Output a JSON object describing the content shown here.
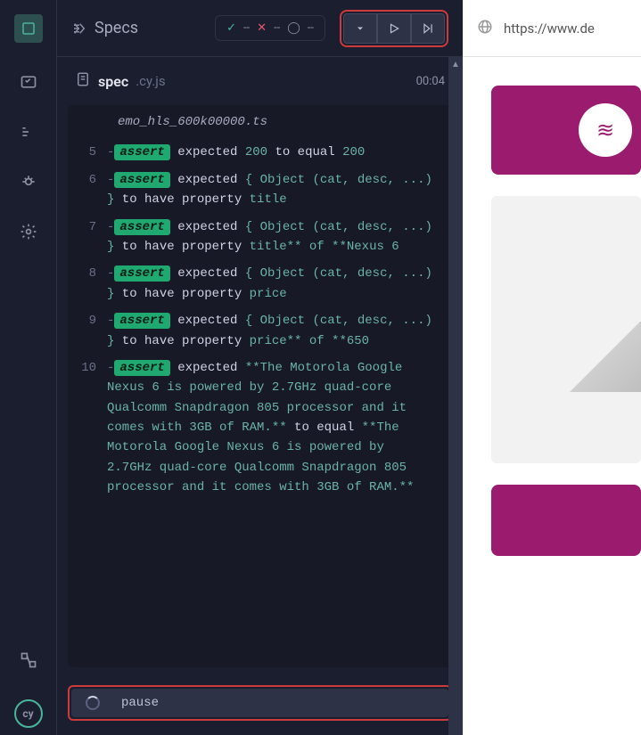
{
  "header": {
    "title": "Specs",
    "stats": {
      "pass": "--",
      "fail": "--",
      "pending": "--"
    }
  },
  "spec": {
    "name": "spec",
    "ext": ".cy.js",
    "time": "00:04"
  },
  "preamble": "emo_hls_600k00000.ts",
  "log": [
    {
      "n": "5",
      "parts": [
        {
          "t": "tag",
          "v": "assert"
        },
        {
          "t": "txt",
          "v": "  expected "
        },
        {
          "t": "kw",
          "v": "200"
        },
        {
          "t": "txt",
          "v": " to equal "
        },
        {
          "t": "kw",
          "v": "200"
        }
      ]
    },
    {
      "n": "6",
      "parts": [
        {
          "t": "tag",
          "v": "assert"
        },
        {
          "t": "txt",
          "v": "  expected "
        },
        {
          "t": "kw",
          "v": "{ Object (cat, desc, ...) }"
        },
        {
          "t": "txt",
          "v": " to have property "
        },
        {
          "t": "kw",
          "v": "title"
        }
      ]
    },
    {
      "n": "7",
      "parts": [
        {
          "t": "tag",
          "v": "assert"
        },
        {
          "t": "txt",
          "v": "  expected "
        },
        {
          "t": "kw",
          "v": "{ Object (cat, desc, ...) }"
        },
        {
          "t": "txt",
          "v": " to have property "
        },
        {
          "t": "kw",
          "v": "title** of **Nexus 6"
        }
      ]
    },
    {
      "n": "8",
      "parts": [
        {
          "t": "tag",
          "v": "assert"
        },
        {
          "t": "txt",
          "v": "  expected "
        },
        {
          "t": "kw",
          "v": "{ Object (cat, desc, ...) }"
        },
        {
          "t": "txt",
          "v": " to have property "
        },
        {
          "t": "kw",
          "v": "price"
        }
      ]
    },
    {
      "n": "9",
      "parts": [
        {
          "t": "tag",
          "v": "assert"
        },
        {
          "t": "txt",
          "v": "  expected "
        },
        {
          "t": "kw",
          "v": "{ Object (cat, desc, ...) }"
        },
        {
          "t": "txt",
          "v": " to have property "
        },
        {
          "t": "kw",
          "v": "price** of **650"
        }
      ]
    },
    {
      "n": "10",
      "parts": [
        {
          "t": "tag",
          "v": "assert"
        },
        {
          "t": "txt",
          "v": "  expected "
        },
        {
          "t": "kw",
          "v": "**The Motorola Google Nexus 6 is powered by 2.7GHz quad-core Qualcomm Snapdragon 805 processor and it comes with 3GB of RAM.**"
        },
        {
          "t": "txt",
          "v": " to equal "
        },
        {
          "t": "kw",
          "v": "**The Motorola Google Nexus 6 is powered by 2.7GHz quad-core Qualcomm Snapdragon 805 processor and it comes with 3GB of RAM.**"
        }
      ]
    }
  ],
  "pause": {
    "label": "pause"
  },
  "browser": {
    "url": "https://www.de"
  },
  "logo": "cy"
}
